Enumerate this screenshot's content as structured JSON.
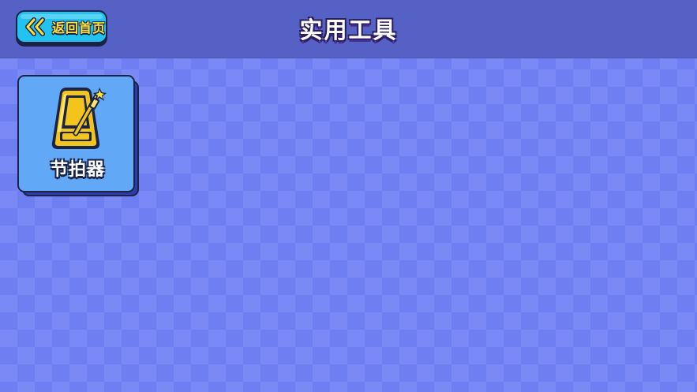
{
  "header": {
    "title": "实用工具",
    "back_button": {
      "label": "返回首页",
      "icon": "double-chevron-left-icon"
    }
  },
  "tools": [
    {
      "label": "节拍器",
      "icon": "metronome-icon"
    }
  ],
  "colors": {
    "background": "#6f7ef0",
    "topbar": "#5561c4",
    "back_button": "#22c3f0",
    "card": "#61a9f7",
    "accent_yellow": "#ffe23a",
    "outline": "#1a2345"
  }
}
